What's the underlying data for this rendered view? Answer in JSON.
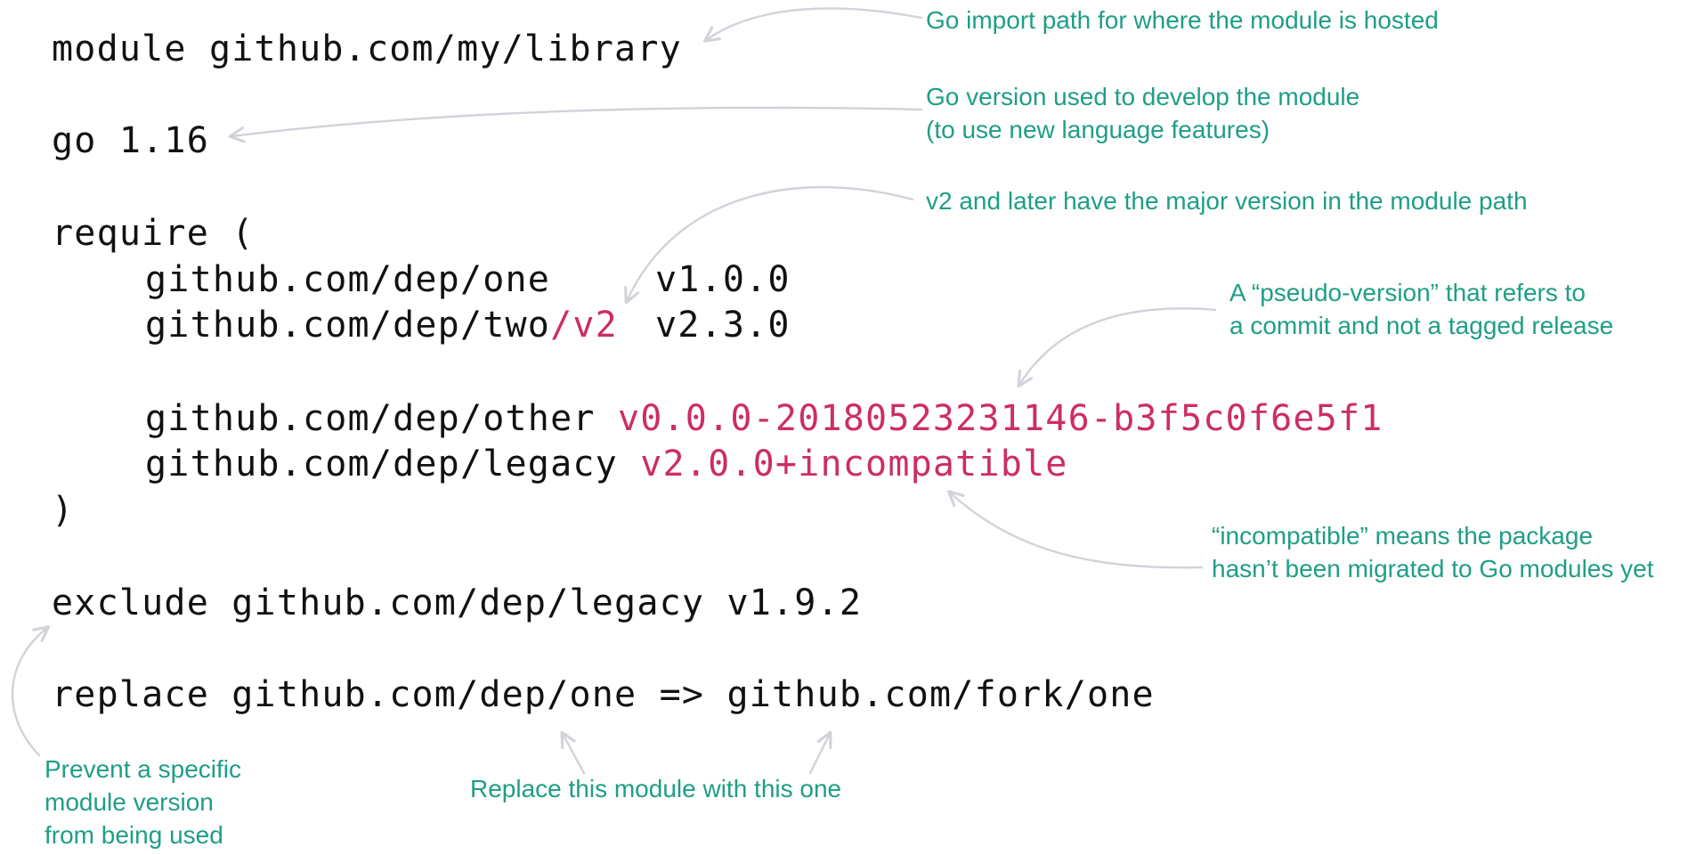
{
  "colors": {
    "code": "#111111",
    "highlight": "#cc2d67",
    "annotation": "#1f9e86",
    "arrow": "#d2d2da"
  },
  "code": {
    "module_line": "module github.com/my/library",
    "go_line": "go 1.16",
    "require_open": "require (",
    "dep_one_path": "github.com/dep/one",
    "dep_one_version": "v1.0.0",
    "dep_two_path": "github.com/dep/two",
    "dep_two_suffix": "/v2",
    "dep_two_version": "v2.3.0",
    "dep_other_path": "github.com/dep/other",
    "dep_other_version": "v0.0.0-20180523231146-b3f5c0f6e5f1",
    "dep_legacy_path": "github.com/dep/legacy",
    "dep_legacy_version": "v2.0.0+incompatible",
    "require_close": ")",
    "exclude_line": "exclude github.com/dep/legacy v1.9.2",
    "replace_line": "replace github.com/dep/one => github.com/fork/one"
  },
  "annotations": {
    "module_path": "Go import path for where the module is hosted",
    "go_version": "Go version used to develop the module\n(to use new language features)",
    "major_version": "v2 and later have the major version in the module path",
    "pseudo_version": "A “pseudo-version” that refers to\na commit and not a tagged release",
    "incompatible": "“incompatible” means the package\nhasn’t been migrated to Go modules yet",
    "exclude": "Prevent a specific\nmodule version\nfrom being used",
    "replace": "Replace this module with this one"
  }
}
